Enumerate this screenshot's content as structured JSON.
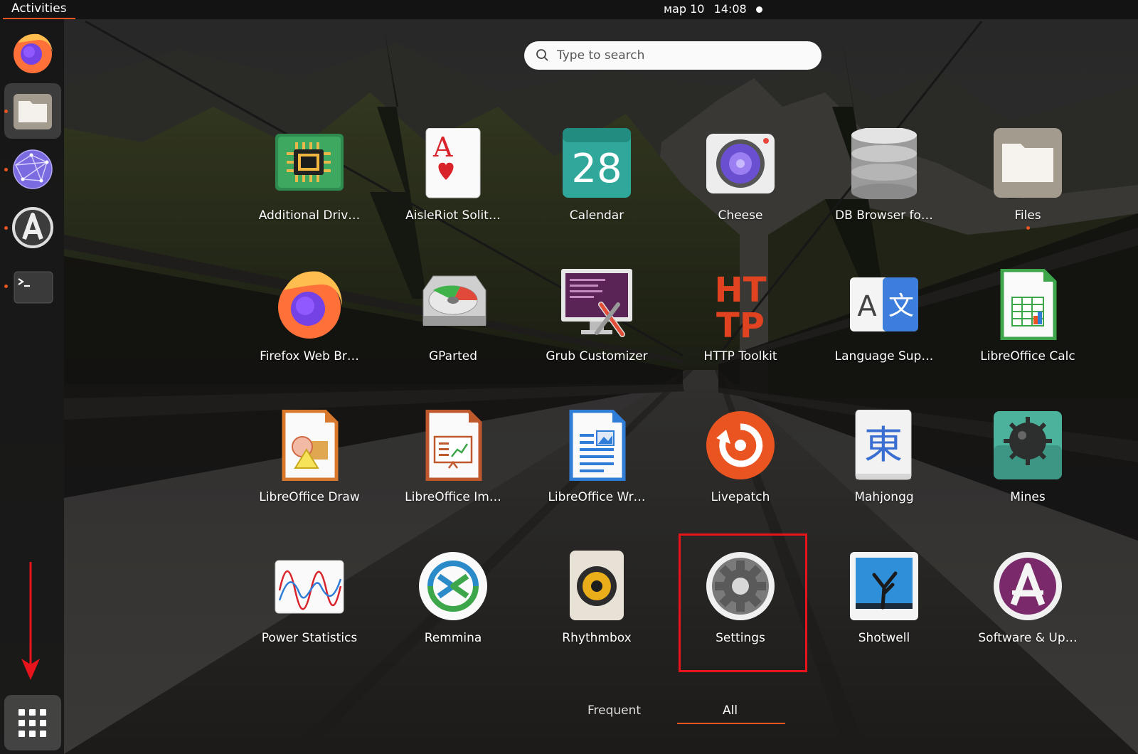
{
  "topbar": {
    "activities_label": "Activities",
    "date": "мар 10",
    "time": "14:08"
  },
  "dock": {
    "items": [
      {
        "name": "Firefox",
        "icon": "firefox-icon",
        "running": false
      },
      {
        "name": "Files",
        "icon": "files-folder-icon",
        "running": true,
        "active": true
      },
      {
        "name": "Web Browser",
        "icon": "globe-network-icon",
        "running": true
      },
      {
        "name": "Software Updater",
        "icon": "software-updater-icon",
        "running": true
      },
      {
        "name": "Terminal",
        "icon": "terminal-icon",
        "running": true
      }
    ],
    "show_apps_icon": "grid-dots-icon"
  },
  "search": {
    "placeholder": "Type to search"
  },
  "apps": [
    {
      "label": "Additional Driv…",
      "icon": "chip-icon"
    },
    {
      "label": "AisleRiot Solit…",
      "icon": "playing-card-icon"
    },
    {
      "label": "Calendar",
      "icon": "calendar-icon",
      "day": "28"
    },
    {
      "label": "Cheese",
      "icon": "webcam-icon"
    },
    {
      "label": "DB Browser fo…",
      "icon": "database-icon"
    },
    {
      "label": "Files",
      "icon": "files-folder-icon",
      "running": true
    },
    {
      "label": "Firefox Web Br…",
      "icon": "firefox-icon"
    },
    {
      "label": "GParted",
      "icon": "harddisk-icon"
    },
    {
      "label": "Grub Customizer",
      "icon": "grub-monitor-icon"
    },
    {
      "label": "HTTP Toolkit",
      "icon": "http-toolkit-icon",
      "icon_text_1": "HT",
      "icon_text_2": "TP"
    },
    {
      "label": "Language Sup…",
      "icon": "language-icon",
      "icon_text_1": "A",
      "icon_text_2": "文"
    },
    {
      "label": "LibreOffice Calc",
      "icon": "spreadsheet-icon"
    },
    {
      "label": "LibreOffice Draw",
      "icon": "draw-icon"
    },
    {
      "label": "LibreOffice Im…",
      "icon": "presentation-icon"
    },
    {
      "label": "LibreOffice Wr…",
      "icon": "writer-document-icon"
    },
    {
      "label": "Livepatch",
      "icon": "livepatch-icon"
    },
    {
      "label": "Mahjongg",
      "icon": "mahjongg-tile-icon",
      "icon_text_1": "東"
    },
    {
      "label": "Mines",
      "icon": "mine-icon"
    },
    {
      "label": "Power Statistics",
      "icon": "power-graph-icon"
    },
    {
      "label": "Remmina",
      "icon": "remmina-icon"
    },
    {
      "label": "Rhythmbox",
      "icon": "speaker-icon"
    },
    {
      "label": "Settings",
      "icon": "gear-icon"
    },
    {
      "label": "Shotwell",
      "icon": "photo-tree-icon"
    },
    {
      "label": "Software & Up…",
      "icon": "software-updater-icon"
    }
  ],
  "tabs": {
    "frequent_label": "Frequent",
    "all_label": "All",
    "active": "All"
  },
  "colors": {
    "accent": "#e95420",
    "highlight": "#e8141b"
  }
}
